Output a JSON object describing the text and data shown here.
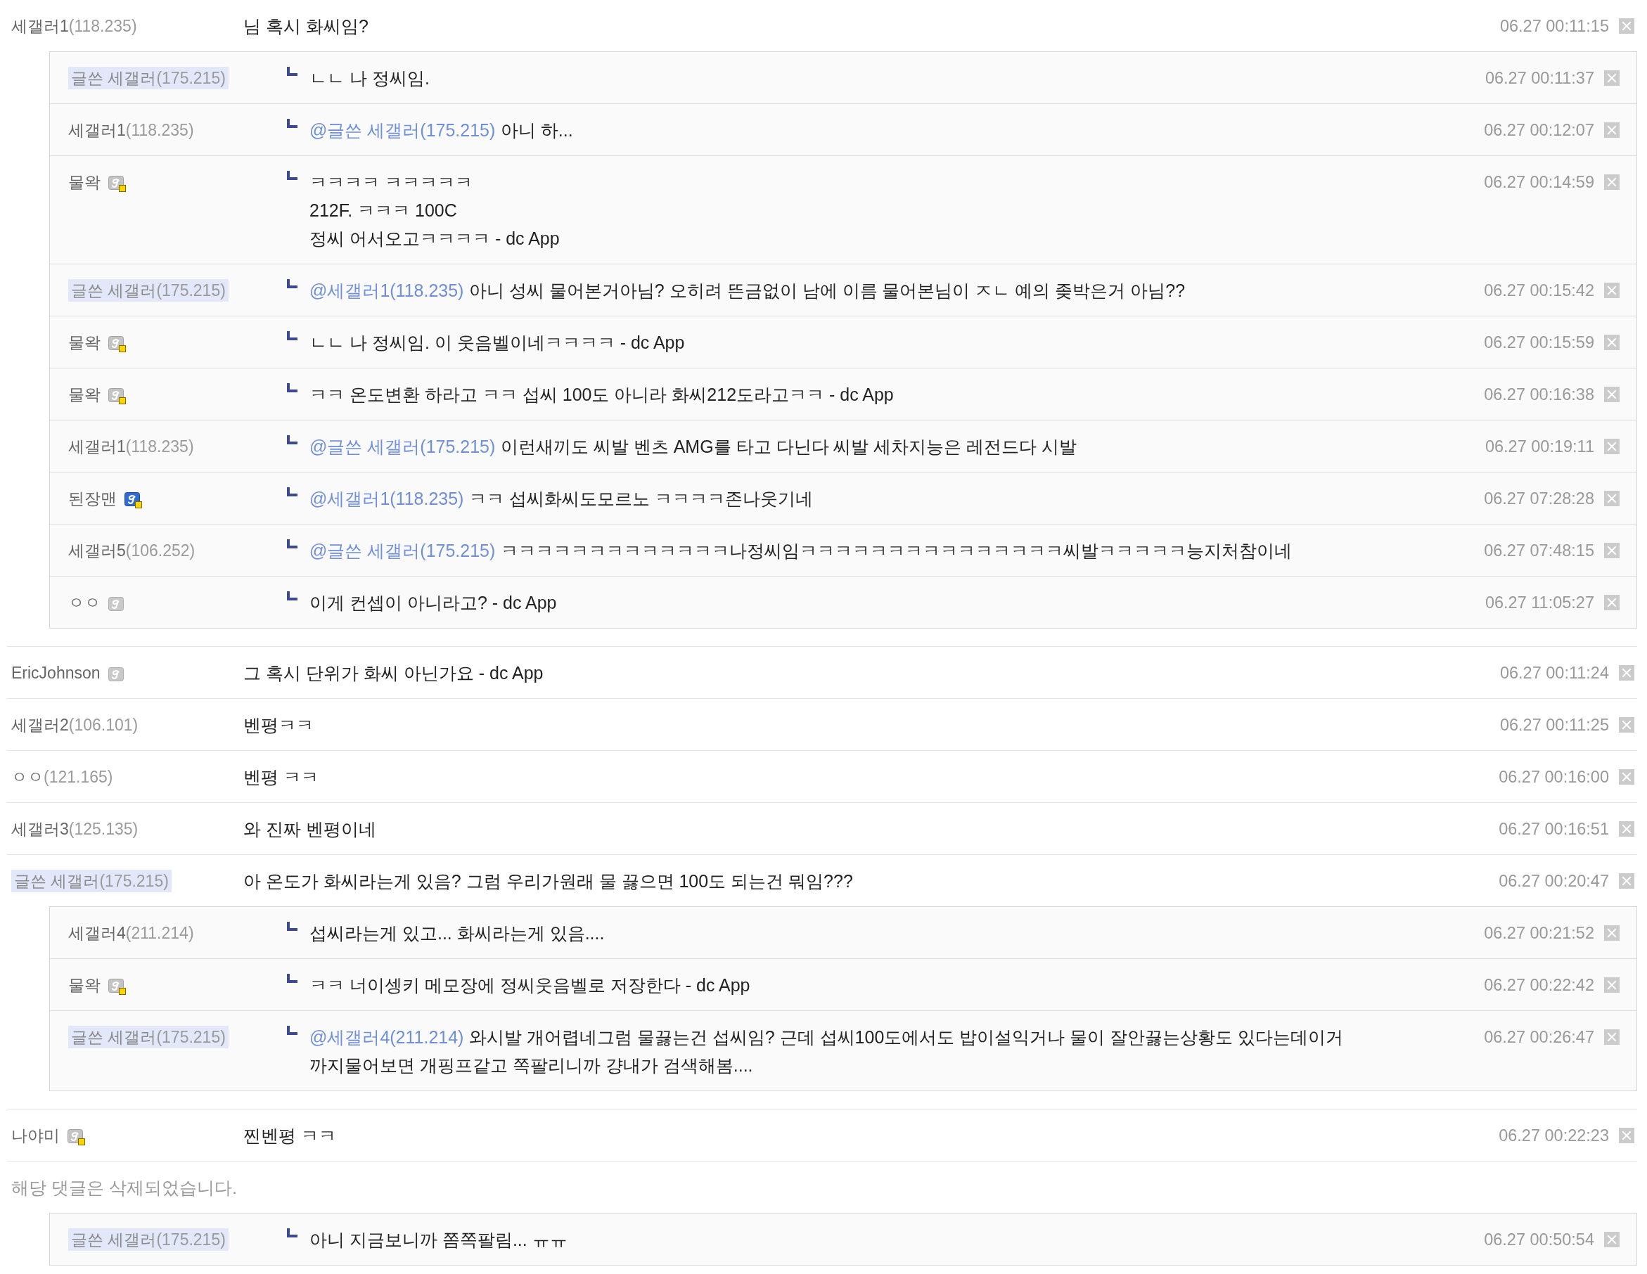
{
  "comments": [
    {
      "kind": "comment",
      "name": "세갤러1",
      "ip": "(118.235)",
      "writer": false,
      "text": "님 혹시 화씨임?",
      "time": "06.27 00:11:15",
      "replies": [
        {
          "name": "글쓴 세갤러",
          "ip": "(175.215)",
          "writer": true,
          "text": "ㄴㄴ 나 정씨임.",
          "time": "06.27 00:11:37"
        },
        {
          "name": "세갤러1",
          "ip": "(118.235)",
          "writer": false,
          "mention": "@글쓴 세갤러(175.215)",
          "text": "아니 하...",
          "time": "06.27 00:12:07"
        },
        {
          "name": "물왁",
          "badge": {
            "kind": "dotted"
          },
          "writer": false,
          "text": "ㅋㅋㅋㅋ ㅋㅋㅋㅋㅋ\n212F. ㅋㅋㅋ 100C\n정씨 어서오고ㅋㅋㅋㅋ - dc App",
          "time": "06.27 00:14:59"
        },
        {
          "name": "글쓴 세갤러",
          "ip": "(175.215)",
          "writer": true,
          "mention": "@세갤러1(118.235)",
          "text": "아니 성씨 물어본거아님? 오히려 뜬금없이 남에 이름 물어본님이 ㅈㄴ 예의 좆박은거 아님??",
          "time": "06.27 00:15:42"
        },
        {
          "name": "물왁",
          "badge": {
            "kind": "dotted"
          },
          "writer": false,
          "text": "ㄴㄴ 나 정씨임. 이 웃음벨이네ㅋㅋㅋㅋ - dc App",
          "time": "06.27 00:15:59"
        },
        {
          "name": "물왁",
          "badge": {
            "kind": "dotted"
          },
          "writer": false,
          "text": "ㅋㅋ 온도변환 하라고 ㅋㅋ 섭씨 100도 아니라 화씨212도라고ㅋㅋ - dc App",
          "time": "06.27 00:16:38"
        },
        {
          "name": "세갤러1",
          "ip": "(118.235)",
          "writer": false,
          "mention": "@글쓴 세갤러(175.215)",
          "text": "이런새끼도 씨발 벤츠 AMG를 타고 다닌다 씨발 세차지능은 레전드다 시발",
          "time": "06.27 00:19:11"
        },
        {
          "name": "된장맨",
          "badge": {
            "kind": "blue"
          },
          "writer": false,
          "mention": "@세갤러1(118.235)",
          "text": "ㅋㅋ 섭씨화씨도모르노 ㅋㅋㅋㅋ존나웃기네",
          "time": "06.27 07:28:28"
        },
        {
          "name": "세갤러5",
          "ip": "(106.252)",
          "writer": false,
          "mention": "@글쓴 세갤러(175.215)",
          "text": "ㅋㅋㅋㅋㅋㅋㅋㅋㅋㅋㅋㅋㅋ나정씨임ㅋㅋㅋㅋㅋㅋㅋㅋㅋㅋㅋㅋㅋㅋㅋ씨발ㅋㅋㅋㅋㅋ능지처참이네",
          "time": "06.27 07:48:15"
        },
        {
          "name": "ㅇㅇ",
          "badge": {
            "kind": "plain"
          },
          "writer": false,
          "text": "이게 컨셉이 아니라고? - dc App",
          "time": "06.27 11:05:27"
        }
      ]
    },
    {
      "kind": "comment",
      "name": "EricJohnson",
      "badge": {
        "kind": "plain"
      },
      "writer": false,
      "text": "그 혹시 단위가 화씨 아닌가요 - dc App",
      "time": "06.27 00:11:24"
    },
    {
      "kind": "comment",
      "name": "세갤러2",
      "ip": "(106.101)",
      "writer": false,
      "text": "벤평ㅋㅋ",
      "time": "06.27 00:11:25"
    },
    {
      "kind": "comment",
      "name": "ㅇㅇ",
      "ip": "(121.165)",
      "writer": false,
      "text": "벤평 ㅋㅋ",
      "time": "06.27 00:16:00"
    },
    {
      "kind": "comment",
      "name": "세갤러3",
      "ip": "(125.135)",
      "writer": false,
      "text": "와 진짜 벤평이네",
      "time": "06.27 00:16:51"
    },
    {
      "kind": "comment",
      "name": "글쓴 세갤러",
      "ip": "(175.215)",
      "writer": true,
      "text": "아 온도가 화씨라는게 있음? 그럼 우리가원래 물 끓으면 100도 되는건 뭐임???",
      "time": "06.27 00:20:47",
      "replies": [
        {
          "name": "세갤러4",
          "ip": "(211.214)",
          "writer": false,
          "text": "섭씨라는게 있고... 화씨라는게 있음....",
          "time": "06.27 00:21:52"
        },
        {
          "name": "물왁",
          "badge": {
            "kind": "dotted"
          },
          "writer": false,
          "text": "ㅋㅋ 너이셍키 메모장에 정씨웃음벨로 저장한다 - dc App",
          "time": "06.27 00:22:42"
        },
        {
          "name": "글쓴 세갤러",
          "ip": "(175.215)",
          "writer": true,
          "mention": "@세갤러4(211.214)",
          "text": "와시발 개어렵네그럼 물끓는건 섭씨임? 근데 섭씨100도에서도 밥이설익거나 물이 잘안끓는상황도 있다는데이거\n까지물어보면 개핑프같고 쪽팔리니까 걍내가 검색해봄....",
          "time": "06.27 00:26:47"
        }
      ]
    },
    {
      "kind": "comment",
      "name": "나야미",
      "badge": {
        "kind": "dotted"
      },
      "writer": false,
      "text": "찐벤평 ㅋㅋ",
      "time": "06.27 00:22:23"
    },
    {
      "kind": "deleted",
      "text": "해당 댓글은 삭제되었습니다.",
      "replies": [
        {
          "name": "글쓴 세갤러",
          "ip": "(175.215)",
          "writer": true,
          "text": "아니 지금보니까 쫌쪽팔림... ㅠㅠ",
          "time": "06.27 00:50:54"
        }
      ]
    }
  ]
}
